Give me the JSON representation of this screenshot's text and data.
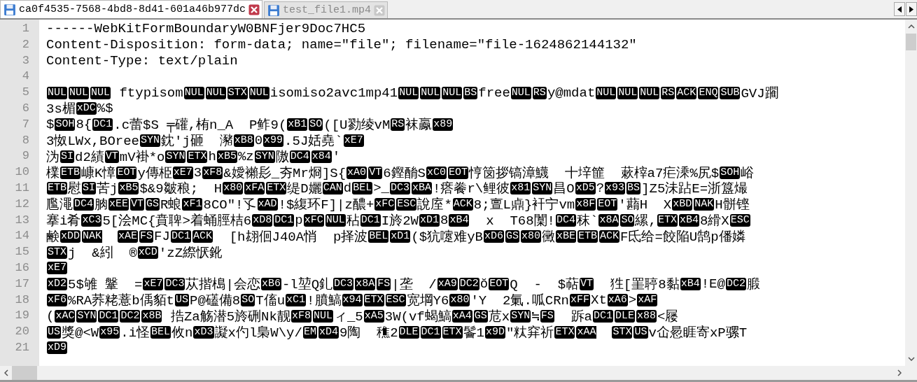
{
  "tabs": [
    {
      "title": "ca0f4535-7568-4bd8-8d41-601a46b977dc",
      "selected": true
    },
    {
      "title": "test_file1.mp4",
      "selected": false
    }
  ],
  "editor": {
    "lines": [
      {
        "number": "1",
        "segments": [
          {
            "kind": "text",
            "text": "------WebKitFormBoundaryW0BNFjer9Doc7HC5"
          }
        ]
      },
      {
        "number": "2",
        "segments": [
          {
            "kind": "text",
            "text": "Content-Disposition: form-data; name=\"file\"; filename=\"file-1624862144132\""
          }
        ]
      },
      {
        "number": "3",
        "segments": [
          {
            "kind": "text",
            "text": "Content-Type: text/plain"
          }
        ]
      },
      {
        "number": "4"
      },
      {
        "number": "5",
        "segments": [
          {
            "kind": "ctrl",
            "text": "NUL"
          },
          {
            "kind": "ctrl",
            "text": "NUL"
          },
          {
            "kind": "ctrl",
            "text": "NUL"
          },
          {
            "kind": "text",
            "text": " ftypisom"
          },
          {
            "kind": "ctrl",
            "text": "NUL"
          },
          {
            "kind": "ctrl",
            "text": "NUL"
          },
          {
            "kind": "ctrl",
            "text": "STX"
          },
          {
            "kind": "ctrl",
            "text": "NUL"
          },
          {
            "kind": "text",
            "text": "isomiso2avc1mp41"
          },
          {
            "kind": "ctrl",
            "text": "NUL"
          },
          {
            "kind": "ctrl",
            "text": "NUL"
          },
          {
            "kind": "ctrl",
            "text": "NUL"
          },
          {
            "kind": "ctrl",
            "text": "BS"
          },
          {
            "kind": "text",
            "text": "free"
          },
          {
            "kind": "ctrl",
            "text": "NUL"
          },
          {
            "kind": "ctrl",
            "text": "RS"
          },
          {
            "kind": "text",
            "text": "y@mdat"
          },
          {
            "kind": "ctrl",
            "text": "NUL"
          },
          {
            "kind": "ctrl",
            "text": "NUL"
          },
          {
            "kind": "ctrl",
            "text": "NUL"
          },
          {
            "kind": "ctrl",
            "text": "RS"
          },
          {
            "kind": "ctrl",
            "text": "ACK"
          },
          {
            "kind": "ctrl",
            "text": "ENQ"
          },
          {
            "kind": "ctrl",
            "text": "SUB"
          },
          {
            "kind": "text",
            "text": "GVJ躙"
          }
        ]
      },
      {
        "number": "6",
        "segments": [
          {
            "kind": "text",
            "text": "3s楣"
          },
          {
            "kind": "ctrl",
            "text": "xDC"
          },
          {
            "kind": "text",
            "text": "%$"
          }
        ]
      },
      {
        "number": "7",
        "segments": [
          {
            "kind": "text",
            "text": "$"
          },
          {
            "kind": "ctrl",
            "text": "SOH"
          },
          {
            "kind": "text",
            "text": "8{"
          },
          {
            "kind": "ctrl",
            "text": "DC1"
          },
          {
            "kind": "text",
            "text": ".c蕾$S ╤礶,栯n_A  P鲊9("
          },
          {
            "kind": "ctrl",
            "text": "xB1"
          },
          {
            "kind": "ctrl",
            "text": "SO"
          },
          {
            "kind": "text",
            "text": "([U勠绫vM"
          },
          {
            "kind": "ctrl",
            "text": "RS"
          },
          {
            "kind": "text",
            "text": "袜鸁"
          },
          {
            "kind": "ctrl",
            "text": "x89"
          }
        ]
      },
      {
        "number": "8",
        "segments": [
          {
            "kind": "text",
            "text": "3怓LWx,BOree"
          },
          {
            "kind": "ctrl",
            "text": "SYN"
          },
          {
            "kind": "text",
            "text": "鈂'j砸  瀦"
          },
          {
            "kind": "ctrl",
            "text": "xB8"
          },
          {
            "kind": "text",
            "text": "0"
          },
          {
            "kind": "ctrl",
            "text": "x99"
          },
          {
            "kind": "text",
            "text": ".5J姡堯`"
          },
          {
            "kind": "ctrl",
            "text": "xE7"
          }
        ]
      },
      {
        "number": "9",
        "segments": [
          {
            "kind": "text",
            "text": "沩"
          },
          {
            "kind": "ctrl",
            "text": "SI"
          },
          {
            "kind": "text",
            "text": "d2績"
          },
          {
            "kind": "ctrl",
            "text": "VT"
          },
          {
            "kind": "text",
            "text": "mV褂*o"
          },
          {
            "kind": "ctrl",
            "text": "SYN"
          },
          {
            "kind": "ctrl",
            "text": "ETX"
          },
          {
            "kind": "text",
            "text": "h"
          },
          {
            "kind": "ctrl",
            "text": "xB5"
          },
          {
            "kind": "text",
            "text": "%z"
          },
          {
            "kind": "ctrl",
            "text": "SYN"
          },
          {
            "kind": "text",
            "text": "隞"
          },
          {
            "kind": "ctrl",
            "text": "DC4"
          },
          {
            "kind": "ctrl",
            "text": "x84"
          },
          {
            "kind": "text",
            "text": "'"
          }
        ]
      },
      {
        "number": "10",
        "segments": [
          {
            "kind": "text",
            "text": "檏"
          },
          {
            "kind": "ctrl",
            "text": "ETB"
          },
          {
            "kind": "text",
            "text": "嵻K慞"
          },
          {
            "kind": "ctrl",
            "text": "EOT"
          },
          {
            "kind": "text",
            "text": "y傳栕"
          },
          {
            "kind": "ctrl",
            "text": "xE7"
          },
          {
            "kind": "text",
            "text": "3"
          },
          {
            "kind": "ctrl",
            "text": "xF8"
          },
          {
            "kind": "text",
            "text": "&嬡襰髟_夯Mr烱]S{"
          },
          {
            "kind": "ctrl",
            "text": "xA0"
          },
          {
            "kind": "ctrl",
            "text": "VT"
          },
          {
            "kind": "text",
            "text": "6鏗酳S"
          },
          {
            "kind": "ctrl",
            "text": "xC0"
          },
          {
            "kind": "ctrl",
            "text": "EOT"
          },
          {
            "kind": "text",
            "text": "悙笝拶镐漳鱴  十垶篚  蔌榟a7疟溗%尻$"
          },
          {
            "kind": "ctrl",
            "text": "SOH"
          },
          {
            "kind": "text",
            "text": "峪"
          }
        ]
      },
      {
        "number": "11",
        "segments": [
          {
            "kind": "ctrl",
            "text": "ETB"
          },
          {
            "kind": "text",
            "text": "慰"
          },
          {
            "kind": "ctrl",
            "text": "SI"
          },
          {
            "kind": "text",
            "text": "苦j"
          },
          {
            "kind": "ctrl",
            "text": "xB5"
          },
          {
            "kind": "text",
            "text": "$&9皺稂;  H"
          },
          {
            "kind": "ctrl",
            "text": "x80"
          },
          {
            "kind": "ctrl",
            "text": "xFA"
          },
          {
            "kind": "ctrl",
            "text": "ETX"
          },
          {
            "kind": "text",
            "text": "缇D孋"
          },
          {
            "kind": "ctrl",
            "text": "CAN"
          },
          {
            "kind": "text",
            "text": "d"
          },
          {
            "kind": "ctrl",
            "text": "BEL"
          },
          {
            "kind": "text",
            "text": ">_"
          },
          {
            "kind": "ctrl",
            "text": "DC3"
          },
          {
            "kind": "ctrl",
            "text": "xBA"
          },
          {
            "kind": "text",
            "text": "!瘩餋r\\鲤彼"
          },
          {
            "kind": "ctrl",
            "text": "x81"
          },
          {
            "kind": "ctrl",
            "text": "SYN"
          },
          {
            "kind": "text",
            "text": "昌O"
          },
          {
            "kind": "ctrl",
            "text": "xD5"
          },
          {
            "kind": "text",
            "text": "?"
          },
          {
            "kind": "ctrl",
            "text": "x93"
          },
          {
            "kind": "ctrl",
            "text": "BS"
          },
          {
            "kind": "text",
            "text": "]Z5沬跕E=浙簋熶"
          }
        ]
      },
      {
        "number": "12",
        "segments": [
          {
            "kind": "text",
            "text": "尶澠"
          },
          {
            "kind": "ctrl",
            "text": "DC4"
          },
          {
            "kind": "text",
            "text": "朒"
          },
          {
            "kind": "ctrl",
            "text": "xEE"
          },
          {
            "kind": "ctrl",
            "text": "VT"
          },
          {
            "kind": "ctrl",
            "text": "GS"
          },
          {
            "kind": "text",
            "text": "R蜋"
          },
          {
            "kind": "ctrl",
            "text": "xF1"
          },
          {
            "kind": "text",
            "text": "8CO\"!孓"
          },
          {
            "kind": "ctrl",
            "text": "xAD"
          },
          {
            "kind": "text",
            "text": "!$緮环F]|z醲+"
          },
          {
            "kind": "ctrl",
            "text": "xFC"
          },
          {
            "kind": "ctrl",
            "text": "ESC"
          },
          {
            "kind": "text",
            "text": "說庢*"
          },
          {
            "kind": "ctrl",
            "text": "ACK"
          },
          {
            "kind": "text",
            "text": "8;亶L鼑}衦宁vm"
          },
          {
            "kind": "ctrl",
            "text": "x8F"
          },
          {
            "kind": "ctrl",
            "text": "EOT"
          },
          {
            "kind": "text",
            "text": "'蘛H  X"
          },
          {
            "kind": "ctrl",
            "text": "xBD"
          },
          {
            "kind": "ctrl",
            "text": "NAK"
          },
          {
            "kind": "text",
            "text": "H骿铿"
          }
        ]
      },
      {
        "number": "13",
        "segments": [
          {
            "kind": "text",
            "text": "搴i肴"
          },
          {
            "kind": "ctrl",
            "text": "xC3"
          },
          {
            "kind": "text",
            "text": "5[浍MC{賁聛>着蛹脛桔6"
          },
          {
            "kind": "ctrl",
            "text": "xD8"
          },
          {
            "kind": "ctrl",
            "text": "DC1"
          },
          {
            "kind": "text",
            "text": "p"
          },
          {
            "kind": "ctrl",
            "text": "xFC"
          },
          {
            "kind": "ctrl",
            "text": "NUL"
          },
          {
            "kind": "text",
            "text": "秥"
          },
          {
            "kind": "ctrl",
            "text": "DC1"
          },
          {
            "kind": "text",
            "text": "I旍2W"
          },
          {
            "kind": "ctrl",
            "text": "xD1"
          },
          {
            "kind": "text",
            "text": "8"
          },
          {
            "kind": "ctrl",
            "text": "xB4"
          },
          {
            "kind": "text",
            "text": "  x  T68闑!"
          },
          {
            "kind": "ctrl",
            "text": "DC4"
          },
          {
            "kind": "text",
            "text": "秣`"
          },
          {
            "kind": "ctrl",
            "text": "x8A"
          },
          {
            "kind": "ctrl",
            "text": "SO"
          },
          {
            "kind": "text",
            "text": "縲,"
          },
          {
            "kind": "ctrl",
            "text": "ETX"
          },
          {
            "kind": "ctrl",
            "text": "xB4"
          },
          {
            "kind": "text",
            "text": "8縎X"
          },
          {
            "kind": "ctrl",
            "text": "ESC"
          }
        ]
      },
      {
        "number": "14",
        "segments": [
          {
            "kind": "text",
            "text": "鹸"
          },
          {
            "kind": "ctrl",
            "text": "xDD"
          },
          {
            "kind": "ctrl",
            "text": "NAK",
            "space_after": true
          },
          {
            "kind": "ctrl",
            "text": "xAE"
          },
          {
            "kind": "ctrl",
            "text": "FS"
          },
          {
            "kind": "text",
            "text": "FJ"
          },
          {
            "kind": "ctrl",
            "text": "DC1"
          },
          {
            "kind": "ctrl",
            "text": "ACK"
          },
          {
            "kind": "text",
            "text": "  [h翃佪J40A悄  p择波"
          },
          {
            "kind": "ctrl",
            "text": "BEL"
          },
          {
            "kind": "ctrl",
            "text": "xD1"
          },
          {
            "kind": "text",
            "text": "($犺嚔难yB"
          },
          {
            "kind": "ctrl",
            "text": "xD6"
          },
          {
            "kind": "ctrl",
            "text": "GS"
          },
          {
            "kind": "ctrl",
            "text": "x80"
          },
          {
            "kind": "text",
            "text": "黴"
          },
          {
            "kind": "ctrl",
            "text": "xBE"
          },
          {
            "kind": "ctrl",
            "text": "ETB"
          },
          {
            "kind": "ctrl",
            "text": "ACK"
          },
          {
            "kind": "text",
            "text": "F氐给=餃陥U鹄p僠嫾"
          }
        ]
      },
      {
        "number": "15",
        "segments": [
          {
            "kind": "ctrl",
            "text": "STX"
          },
          {
            "kind": "text",
            "text": "j  &紖  ®"
          },
          {
            "kind": "ctrl",
            "text": "xCD"
          },
          {
            "kind": "text",
            "text": "'zZ縩恹鈋"
          }
        ]
      },
      {
        "number": "16",
        "segments": [
          {
            "kind": "ctrl",
            "text": "xE7"
          }
        ]
      },
      {
        "number": "17",
        "segments": [
          {
            "kind": "ctrl",
            "text": "xD2"
          },
          {
            "kind": "text",
            "text": "5$雊 鞶  ="
          },
          {
            "kind": "ctrl",
            "text": "xE7"
          },
          {
            "kind": "ctrl",
            "text": "DC3"
          },
          {
            "kind": "text",
            "text": "苁揩槝|会恋"
          },
          {
            "kind": "ctrl",
            "text": "xB6"
          },
          {
            "kind": "text",
            "text": "-l堃Q釓"
          },
          {
            "kind": "ctrl",
            "text": "DC3"
          },
          {
            "kind": "ctrl",
            "text": "x8A"
          },
          {
            "kind": "ctrl",
            "text": "FS"
          },
          {
            "kind": "text",
            "text": "|垄  /"
          },
          {
            "kind": "ctrl",
            "text": "xA9"
          },
          {
            "kind": "ctrl",
            "text": "DC2"
          },
          {
            "kind": "text",
            "text": "ŏ"
          },
          {
            "kind": "ctrl",
            "text": "EOT"
          },
          {
            "kind": "text",
            "text": "Q  -  $萜"
          },
          {
            "kind": "ctrl",
            "text": "VT"
          },
          {
            "kind": "text",
            "text": "  狌[罣聤8黏"
          },
          {
            "kind": "ctrl",
            "text": "xB4"
          },
          {
            "kind": "text",
            "text": "!E@"
          },
          {
            "kind": "ctrl",
            "text": "DC2"
          },
          {
            "kind": "text",
            "text": "腶"
          }
        ]
      },
      {
        "number": "18",
        "segments": [
          {
            "kind": "ctrl",
            "text": "xF6"
          },
          {
            "kind": "text",
            "text": "%RA荞粩薏b偊貊t"
          },
          {
            "kind": "ctrl",
            "text": "US"
          },
          {
            "kind": "text",
            "text": "P@礚備8"
          },
          {
            "kind": "ctrl",
            "text": "SO"
          },
          {
            "kind": "text",
            "text": "T傗u"
          },
          {
            "kind": "ctrl",
            "text": "xC1"
          },
          {
            "kind": "text",
            "text": "!膹鰝"
          },
          {
            "kind": "ctrl",
            "text": "x94"
          },
          {
            "kind": "ctrl",
            "text": "ETX"
          },
          {
            "kind": "ctrl",
            "text": "ESC"
          },
          {
            "kind": "text",
            "text": "宽堈Y6"
          },
          {
            "kind": "ctrl",
            "text": "x80"
          },
          {
            "kind": "text",
            "text": "'Y  2氭.呱CRn"
          },
          {
            "kind": "ctrl",
            "text": "xFF"
          },
          {
            "kind": "text",
            "text": "Xt"
          },
          {
            "kind": "ctrl",
            "text": "xA6"
          },
          {
            "kind": "text",
            "text": ">"
          },
          {
            "kind": "ctrl",
            "text": "xAF"
          }
        ]
      },
      {
        "number": "19",
        "segments": [
          {
            "kind": "text",
            "text": "("
          },
          {
            "kind": "ctrl",
            "text": "xAC"
          },
          {
            "kind": "ctrl",
            "text": "SYN"
          },
          {
            "kind": "ctrl",
            "text": "DC1"
          },
          {
            "kind": "ctrl",
            "text": "DC2"
          },
          {
            "kind": "ctrl",
            "text": "x8B"
          },
          {
            "kind": "text",
            "text": " 捁Za觞潜5旍硎Nk靓"
          },
          {
            "kind": "ctrl",
            "text": "xF8"
          },
          {
            "kind": "ctrl",
            "text": "NUL"
          },
          {
            "kind": "text",
            "text": "ィ_5"
          },
          {
            "kind": "ctrl",
            "text": "xA5"
          },
          {
            "kind": "text",
            "text": "3W(vf蝎鰝"
          },
          {
            "kind": "ctrl",
            "text": "xA4"
          },
          {
            "kind": "ctrl",
            "text": "GS"
          },
          {
            "kind": "text",
            "text": "苊x"
          },
          {
            "kind": "ctrl",
            "text": "SYN"
          },
          {
            "kind": "text",
            "text": "≒"
          },
          {
            "kind": "ctrl",
            "text": "FS"
          },
          {
            "kind": "text",
            "text": "  跅a"
          },
          {
            "kind": "ctrl",
            "text": "DC1"
          },
          {
            "kind": "ctrl",
            "text": "DLE"
          },
          {
            "kind": "ctrl",
            "text": "x88"
          },
          {
            "kind": "text",
            "text": "<屦"
          }
        ]
      },
      {
        "number": "20",
        "segments": [
          {
            "kind": "ctrl",
            "text": "US"
          },
          {
            "kind": "text",
            "text": "獎@<W"
          },
          {
            "kind": "ctrl",
            "text": "x95"
          },
          {
            "kind": "text",
            "text": ".i怪"
          },
          {
            "kind": "ctrl",
            "text": "BEL"
          },
          {
            "kind": "text",
            "text": "攸n"
          },
          {
            "kind": "ctrl",
            "text": "xD3"
          },
          {
            "kind": "text",
            "text": "譺x仢l梟W\\y/"
          },
          {
            "kind": "ctrl",
            "text": "EM"
          },
          {
            "kind": "ctrl",
            "text": "xD4"
          },
          {
            "kind": "text",
            "text": "9陶  穛2"
          },
          {
            "kind": "ctrl",
            "text": "DLE"
          },
          {
            "kind": "ctrl",
            "text": "DC1"
          },
          {
            "kind": "ctrl",
            "text": "ETX"
          },
          {
            "kind": "text",
            "text": "鬠1"
          },
          {
            "kind": "ctrl",
            "text": "x9D"
          },
          {
            "kind": "text",
            "text": "\"粏穽祈"
          },
          {
            "kind": "ctrl",
            "text": "ETX"
          },
          {
            "kind": "ctrl",
            "text": "xAA",
            "space_after": true
          },
          {
            "kind": "ctrl",
            "text": "STX"
          },
          {
            "kind": "ctrl",
            "text": "US"
          },
          {
            "kind": "text",
            "text": "v仚惖睚寄xP骡T"
          }
        ]
      },
      {
        "number": "21",
        "segments": [
          {
            "kind": "ctrl",
            "text": "xD9"
          }
        ]
      }
    ]
  }
}
